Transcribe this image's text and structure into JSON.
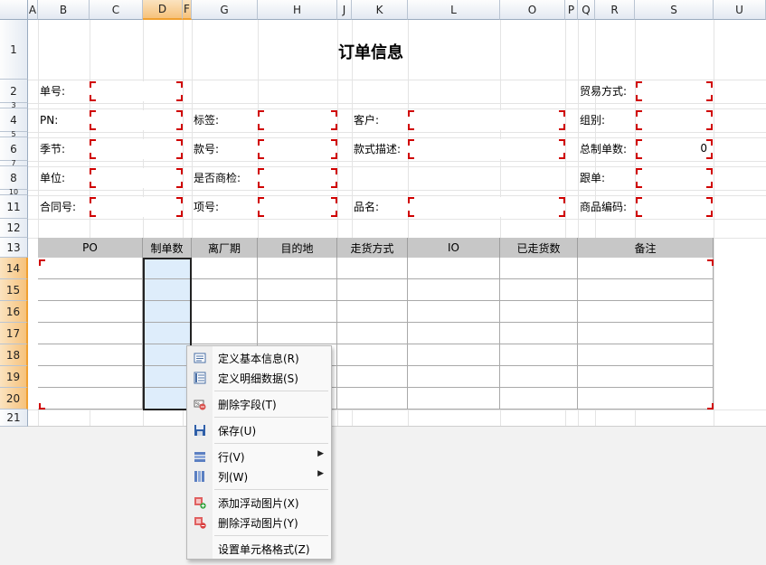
{
  "columns": [
    "A",
    "B",
    "C",
    "D",
    "F",
    "G",
    "H",
    "J",
    "K",
    "L",
    "O",
    "P",
    "Q",
    "R",
    "S",
    "U"
  ],
  "selected_column": "D",
  "rows": [
    "1",
    "2",
    "3",
    "4",
    "5",
    "6",
    "7",
    "8",
    "10",
    "11",
    "12",
    "13",
    "14",
    "15",
    "16",
    "17",
    "18",
    "19",
    "20",
    "21"
  ],
  "selected_rows": [
    "14",
    "15",
    "16",
    "17",
    "18",
    "19",
    "20"
  ],
  "title": "订单信息",
  "labels": {
    "order_no": "单号:",
    "trade_mode": "贸易方式:",
    "pn": "PN:",
    "tag": "标签:",
    "customer": "客户:",
    "group": "组别:",
    "season": "季节:",
    "style_no": "款号:",
    "style_desc": "款式描述:",
    "total_qty": "总制单数:",
    "unit": "单位:",
    "inspection": "是否商检:",
    "follower": "跟单:",
    "contract_no": "合同号:",
    "item_no": "项号:",
    "product_name": "品名:",
    "product_code": "商品编码:"
  },
  "values": {
    "total_qty": "0"
  },
  "table_headers": [
    "PO",
    "制单数",
    "离厂期",
    "目的地",
    "走货方式",
    "IO",
    "已走货数",
    "备注"
  ],
  "context_menu": {
    "items": [
      {
        "label": "定义基本信息(R)",
        "icon": "form-icon"
      },
      {
        "label": "定义明细数据(S)",
        "icon": "detail-list-icon"
      },
      {
        "label": "删除字段(T)",
        "icon": "delete-field-icon"
      },
      {
        "label": "保存(U)",
        "icon": "save-icon"
      },
      {
        "label": "行(V)",
        "icon": "rows-icon",
        "submenu": true
      },
      {
        "label": "列(W)",
        "icon": "columns-icon",
        "submenu": true
      },
      {
        "label": "添加浮动图片(X)",
        "icon": "add-image-icon"
      },
      {
        "label": "删除浮动图片(Y)",
        "icon": "remove-image-icon"
      },
      {
        "label": "设置单元格格式(Z)",
        "icon": ""
      }
    ]
  }
}
